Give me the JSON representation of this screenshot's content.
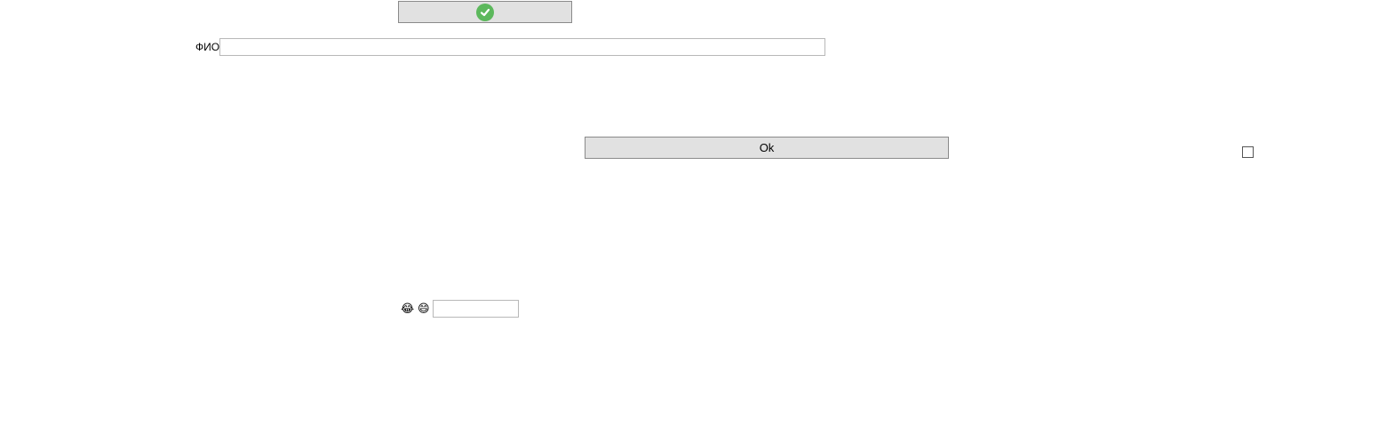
{
  "toolbar": {
    "confirm_icon": "check-circle-icon",
    "confirm_color": "#5cb85c"
  },
  "form": {
    "fio_label": "ФИО",
    "fio_value": "",
    "ok_label": "Ok",
    "checkbox_checked": false,
    "emoji_1": "😂",
    "emoji_2": "😄",
    "small_input_value": ""
  }
}
